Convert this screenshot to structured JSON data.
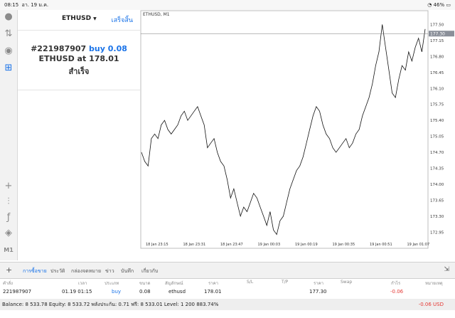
{
  "status": {
    "time": "08:15",
    "date": "อา. 19 ม.ค.",
    "battery": "46%"
  },
  "order_panel": {
    "symbol": "ETHUSD",
    "done_label": "เสร็จสิ้น",
    "result": {
      "ticket": "#221987907",
      "action": "buy 0.08",
      "symbol_line": "ETHUSD at",
      "price": "178.01",
      "status": "สำเร็จ"
    }
  },
  "chart": {
    "title": "ETHUSD, M1",
    "price_ticks": [
      "177.50",
      "177.15",
      "176.80",
      "176.45",
      "176.10",
      "175.75",
      "175.40",
      "175.05",
      "174.70",
      "174.35",
      "174.00",
      "173.65",
      "173.30",
      "172.95"
    ],
    "time_ticks": [
      "18 Jan 23:15",
      "18 Jan 23:31",
      "18 Jan 23:47",
      "19 Jan 00:03",
      "19 Jan 00:19",
      "19 Jan 00:35",
      "19 Jan 00:51",
      "19 Jan 01:07"
    ],
    "current_price": "177.30",
    "series": [
      174.7,
      174.5,
      174.4,
      175.0,
      175.1,
      175.0,
      175.3,
      175.4,
      175.2,
      175.1,
      175.2,
      175.3,
      175.5,
      175.6,
      175.4,
      175.5,
      175.6,
      175.7,
      175.5,
      175.3,
      174.8,
      174.9,
      175.0,
      174.7,
      174.5,
      174.4,
      174.1,
      173.7,
      173.9,
      173.6,
      173.3,
      173.5,
      173.4,
      173.6,
      173.8,
      173.7,
      173.5,
      173.3,
      173.1,
      173.4,
      173.0,
      172.9,
      173.2,
      173.3,
      173.6,
      173.9,
      174.1,
      174.3,
      174.4,
      174.6,
      174.9,
      175.2,
      175.5,
      175.7,
      175.6,
      175.3,
      175.1,
      175.0,
      174.8,
      174.7,
      174.8,
      174.9,
      175.0,
      174.8,
      174.9,
      175.1,
      175.2,
      175.5,
      175.7,
      175.9,
      176.2,
      176.6,
      176.9,
      177.5,
      177.0,
      176.5,
      176.0,
      175.9,
      176.3,
      176.6,
      176.5,
      176.9,
      176.7,
      177.0,
      177.2,
      176.9,
      177.4
    ]
  },
  "tabs": [
    "การซื้อขาย",
    "ประวัติ",
    "กล่องจดหมาย",
    "ข่าว",
    "บันทึก",
    "เกี่ยวกับ"
  ],
  "table": {
    "headers": {
      "symbol": "คำสั่ง",
      "time": "เวลา",
      "type": "ประเภท",
      "volume": "ขนาด",
      "contract": "สัญลักษณ์",
      "price": "ราคา",
      "sl": "S/L",
      "tp": "T/P",
      "current": "ราคา",
      "swap": "Swap",
      "profit": "กำไร",
      "comment": "หมายเหตุ"
    },
    "row": {
      "ticket": "221987907",
      "time": "01.19 01:15",
      "type": "buy",
      "volume": "0.08",
      "symbol": "ethusd",
      "price": "178.01",
      "current": "177.30",
      "profit": "-0.06"
    }
  },
  "balance": {
    "summary": "Balance: 8 533.78 Equity: 8 533.72 พลังประกัน: 0.71 ฟรี: 8 533.01 Level: 1 200 883.74%",
    "profit": "-0.06 USD"
  },
  "colors": {
    "accent": "#1a73e8",
    "loss": "#e53935"
  }
}
